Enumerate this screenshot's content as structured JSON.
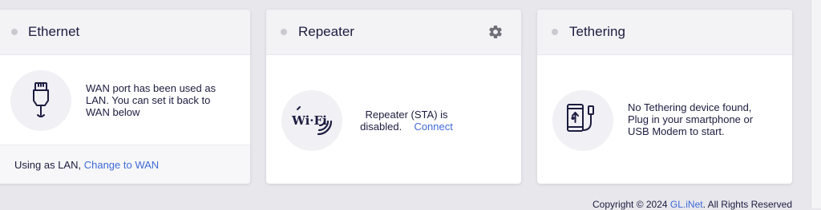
{
  "ethernet": {
    "title": "Ethernet",
    "message": "WAN port has been used as LAN. You can set it back to WAN below",
    "footer_text": "Using as LAN,",
    "footer_link": "Change to WAN",
    "icon": "ethernet-plug-icon"
  },
  "repeater": {
    "title": "Repeater",
    "message_line1": "Repeater (STA) is",
    "message_line2": "disabled.",
    "connect_link": "Connect",
    "icon_text": "Wi·Fi",
    "icon": "wifi-icon",
    "settings_icon": "gear-icon"
  },
  "tethering": {
    "title": "Tethering",
    "message": "No Tethering device found, Plug in your smartphone or USB Modem to start.",
    "icon": "smartphone-usb-icon"
  },
  "footer": {
    "copyright_prefix": "Copyright © 2024",
    "brand_link": "GL.iNet",
    "copyright_suffix": ". All Rights Reserved"
  },
  "colors": {
    "page_bg": "#e7e7ec",
    "card_bg": "#ffffff",
    "header_bg": "#f3f3f6",
    "text": "#1c1c40",
    "link": "#3f6ad8",
    "status_dot": "#c9c9d0"
  }
}
